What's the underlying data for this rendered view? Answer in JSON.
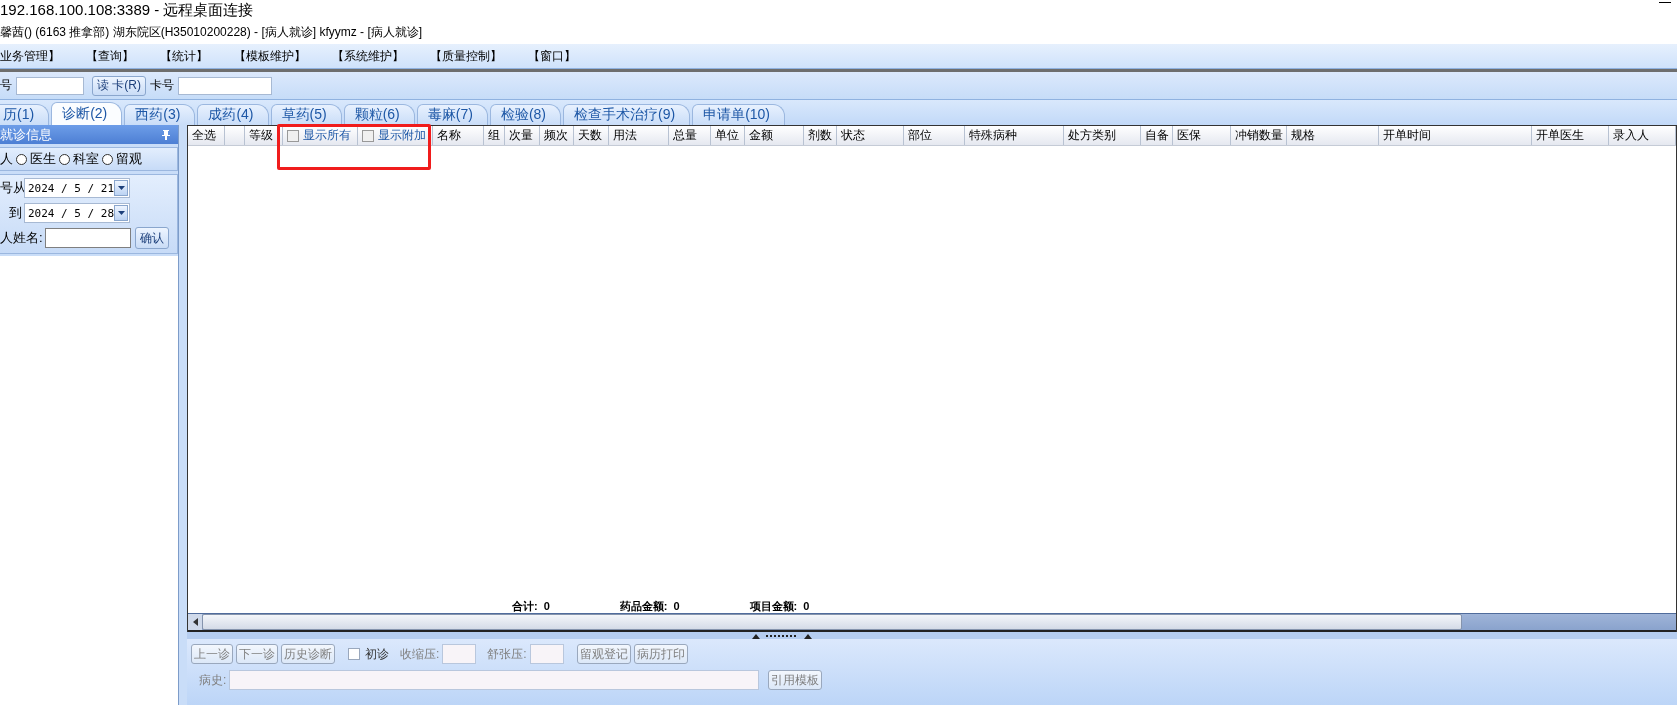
{
  "window": {
    "title": "192.168.100.108:3389 - 远程桌面连接"
  },
  "app_title": "馨茜() (6163 推拿部) 湖东院区(H35010200228) - [病人就诊] kfyymz - [病人就诊]",
  "menu": [
    "业务管理】",
    "【查询】",
    "【统计】",
    "【模板维护】",
    "【系统维护】",
    "【质量控制】",
    "【窗口】"
  ],
  "toolbar": {
    "label": "号",
    "read_card_button": "读 卡(R)",
    "card_label": "卡号"
  },
  "tabs": [
    {
      "label": "历(1)",
      "selected": false
    },
    {
      "label": "诊断(2)",
      "selected": true
    },
    {
      "label": "西药(3)",
      "selected": false
    },
    {
      "label": "成药(4)",
      "selected": false
    },
    {
      "label": "草药(5)",
      "selected": false
    },
    {
      "label": "颗粒(6)",
      "selected": false
    },
    {
      "label": "毒麻(7)",
      "selected": false
    },
    {
      "label": "检验(8)",
      "selected": false
    },
    {
      "label": "检查手术治疗(9)",
      "selected": false
    },
    {
      "label": "申请单(10)",
      "selected": false
    }
  ],
  "left_panel": {
    "title": "就诊信息",
    "radio_options": [
      {
        "label": "人"
      },
      {
        "label": "医生",
        "selected": false
      },
      {
        "label": "科室",
        "selected": false
      },
      {
        "label": "留观",
        "selected": false
      }
    ],
    "date_from": {
      "label": "号从",
      "value": "2024 / 5 / 21"
    },
    "date_to": {
      "label": "到",
      "value": "2024 / 5 / 28"
    },
    "name_label": "人姓名:",
    "confirm_button": "确认"
  },
  "grid": {
    "columns": [
      {
        "kind": "text",
        "label": "全选"
      },
      {
        "kind": "blank"
      },
      {
        "kind": "text",
        "label": "等级"
      },
      {
        "kind": "checkbox",
        "label": "显示所有",
        "checked": false
      },
      {
        "kind": "checkbox",
        "label": "显示附加",
        "checked": false
      },
      {
        "kind": "text",
        "label": "名称"
      },
      {
        "kind": "text",
        "label": "组"
      },
      {
        "kind": "text",
        "label": "次量"
      },
      {
        "kind": "text",
        "label": "频次"
      },
      {
        "kind": "text",
        "label": "天数"
      },
      {
        "kind": "text",
        "label": "用法"
      },
      {
        "kind": "text",
        "label": "总量"
      },
      {
        "kind": "text",
        "label": "单位"
      },
      {
        "kind": "text",
        "label": "金额"
      },
      {
        "kind": "text",
        "label": "剂数"
      },
      {
        "kind": "text",
        "label": "状态"
      },
      {
        "kind": "text",
        "label": "部位"
      },
      {
        "kind": "text",
        "label": "特殊病种"
      },
      {
        "kind": "text",
        "label": "处方类别"
      },
      {
        "kind": "text",
        "label": "自备"
      },
      {
        "kind": "text",
        "label": "医保"
      },
      {
        "kind": "text",
        "label": "冲销数量"
      },
      {
        "kind": "text",
        "label": "规格"
      },
      {
        "kind": "text",
        "label": "开单时间"
      },
      {
        "kind": "text",
        "label": "开单医生"
      },
      {
        "kind": "text",
        "label": "录入人"
      }
    ],
    "totals": [
      {
        "label": "合计:",
        "value": "0"
      },
      {
        "label": "药品金额:",
        "value": "0"
      },
      {
        "label": "项目金额:",
        "value": "0"
      }
    ]
  },
  "bottom": {
    "nav_buttons": [
      {
        "label": "上一诊",
        "disabled": true
      },
      {
        "label": "下一诊",
        "disabled": true
      },
      {
        "label": "历史诊断",
        "disabled": true
      }
    ],
    "first_visit": {
      "label": "初诊",
      "checked": false
    },
    "systolic_label": "收缩压:",
    "diastolic_label": "舒张压:",
    "action_buttons": [
      {
        "label": "留观登记",
        "disabled": true
      },
      {
        "label": "病历打印",
        "disabled": true
      }
    ],
    "history_label": "病史:",
    "template_button": {
      "label": "引用模板",
      "disabled": true
    }
  }
}
